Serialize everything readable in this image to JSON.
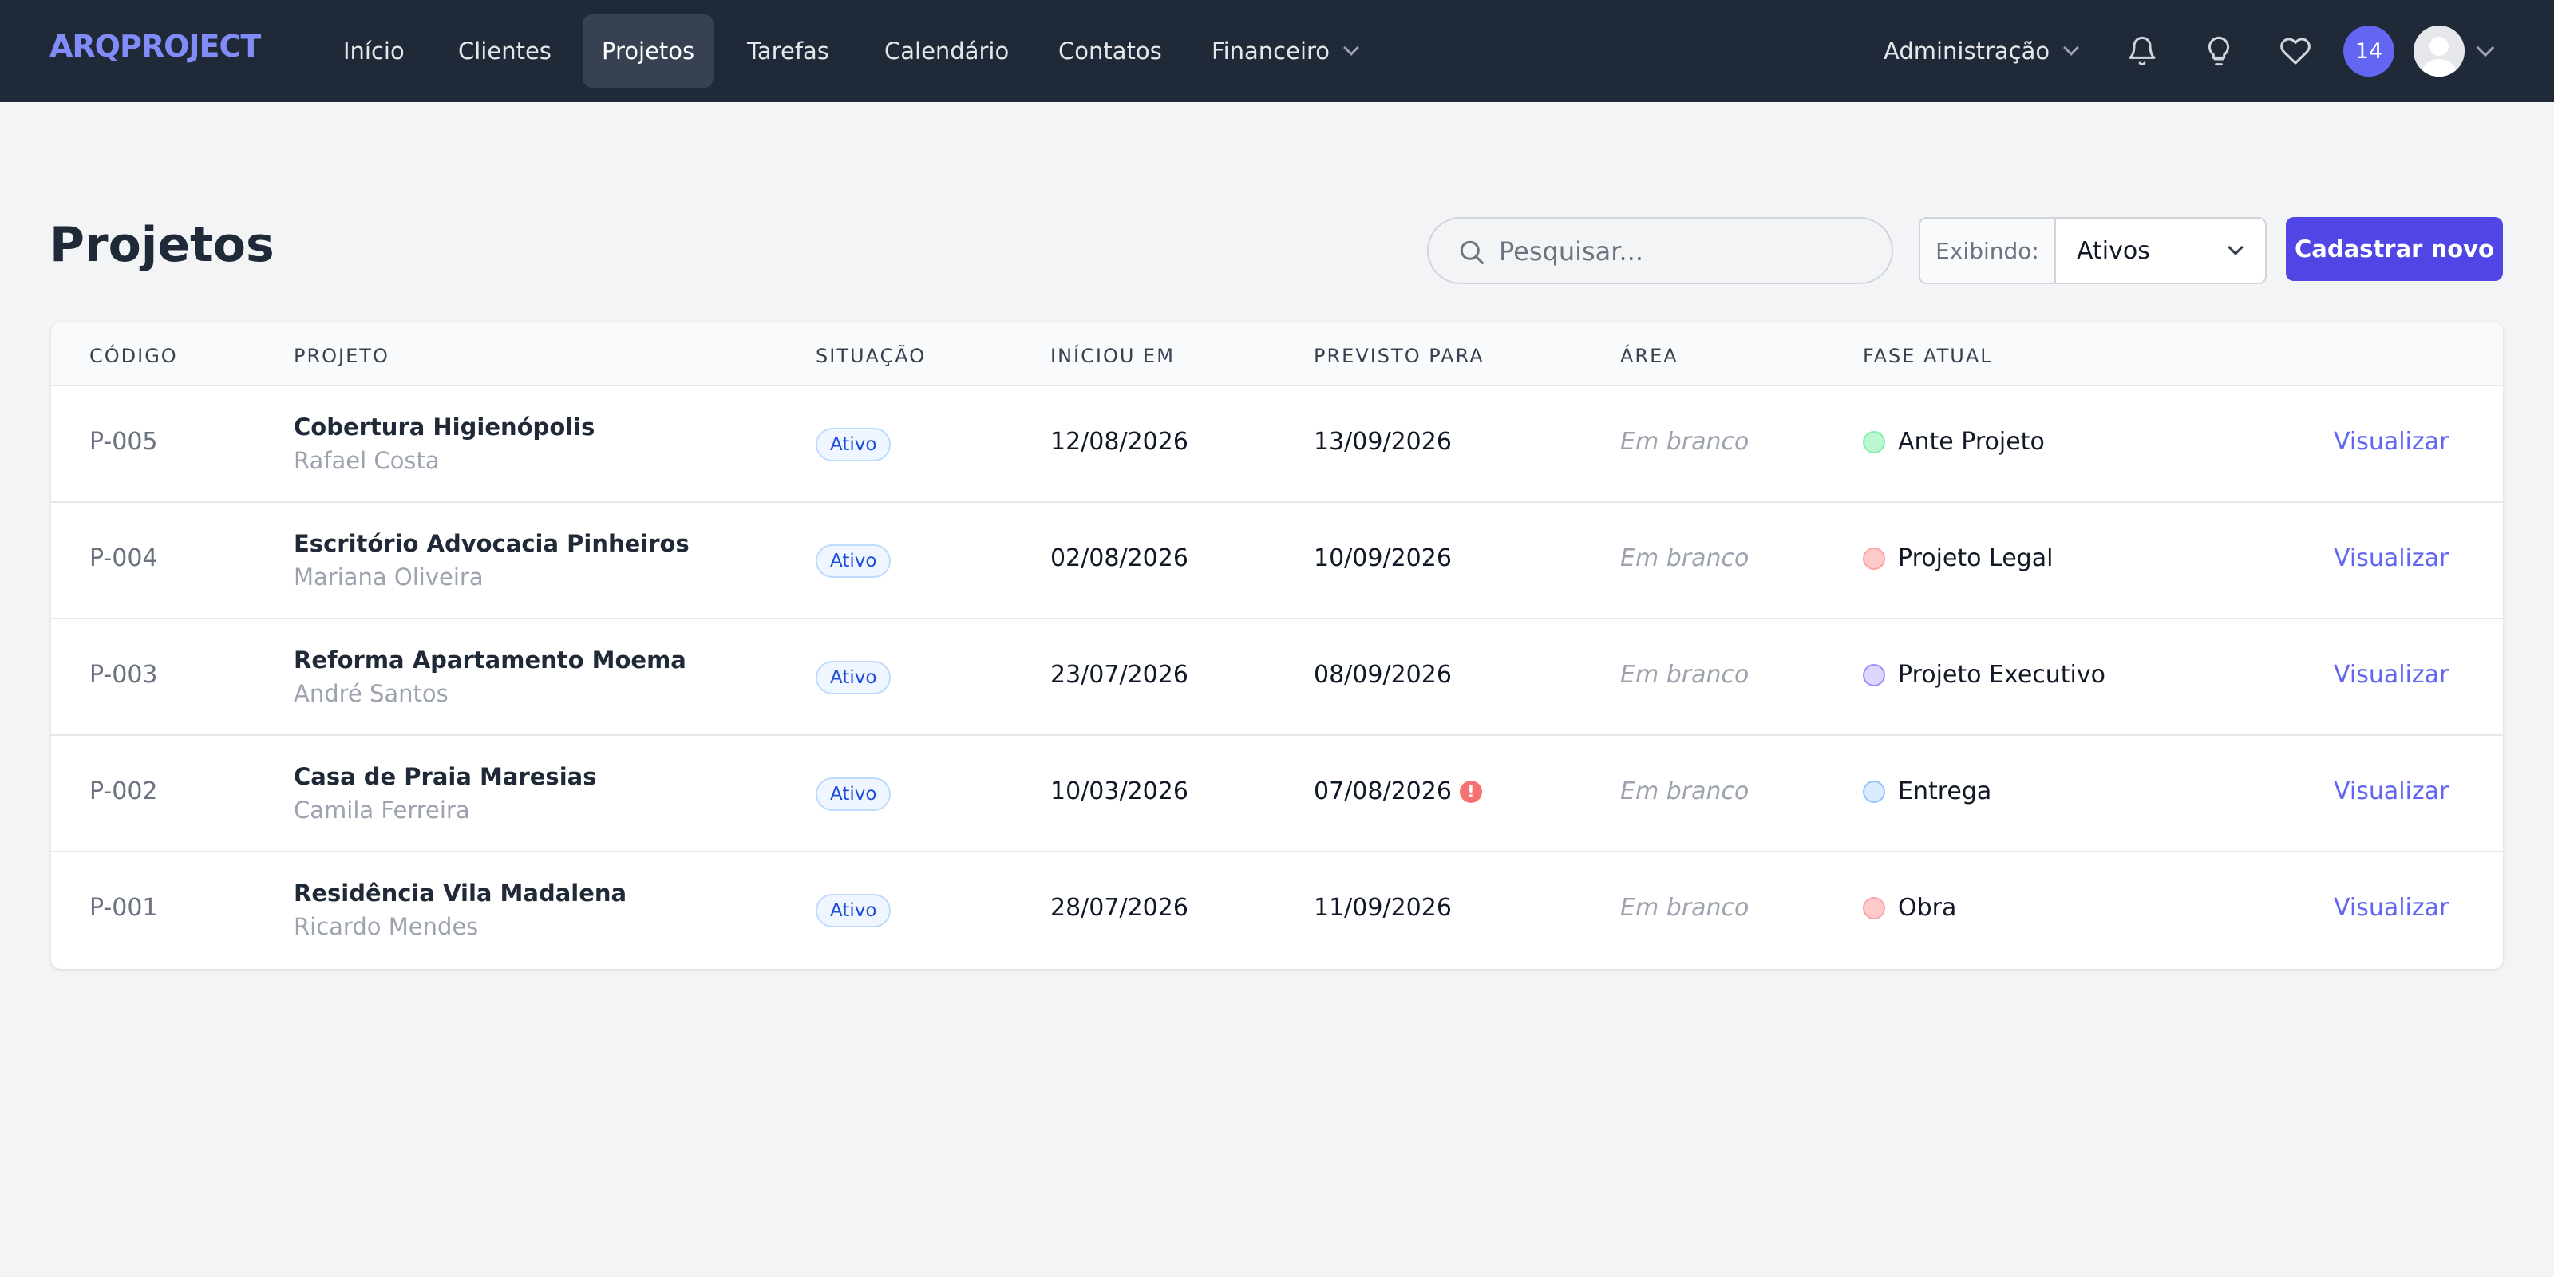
{
  "app": {
    "logo": "ARQPROJECT"
  },
  "nav": {
    "items": [
      {
        "label": "Início"
      },
      {
        "label": "Clientes"
      },
      {
        "label": "Projetos"
      },
      {
        "label": "Tarefas"
      },
      {
        "label": "Calendário"
      },
      {
        "label": "Contatos"
      },
      {
        "label": "Financeiro"
      }
    ],
    "admin_label": "Administração",
    "notification_count": "14"
  },
  "page": {
    "title": "Projetos",
    "search_placeholder": "Pesquisar...",
    "filter_label": "Exibindo:",
    "filter_value": "Ativos",
    "new_button": "Cadastrar novo"
  },
  "table": {
    "headers": {
      "code": "CÓDIGO",
      "project": "PROJETO",
      "status": "SITUAÇÃO",
      "start": "INÍCIOU EM",
      "due": "PREVISTO PARA",
      "area": "ÁREA",
      "phase": "FASE ATUAL"
    },
    "rows": [
      {
        "code": "P-005",
        "name": "Cobertura Higienópolis",
        "client": "Rafael Costa",
        "status": "Ativo",
        "start": "12/08/2026",
        "due": "13/09/2026",
        "area": "Em branco",
        "phase": "Ante Projeto",
        "action": "Visualizar"
      },
      {
        "code": "P-004",
        "name": "Escritório Advocacia Pinheiros",
        "client": "Mariana Oliveira",
        "status": "Ativo",
        "start": "02/08/2026",
        "due": "10/09/2026",
        "area": "Em branco",
        "phase": "Projeto Legal",
        "action": "Visualizar"
      },
      {
        "code": "P-003",
        "name": "Reforma Apartamento Moema",
        "client": "André Santos",
        "status": "Ativo",
        "start": "23/07/2026",
        "due": "08/09/2026",
        "area": "Em branco",
        "phase": "Projeto Executivo",
        "action": "Visualizar"
      },
      {
        "code": "P-002",
        "name": "Casa de Praia Maresias",
        "client": "Camila Ferreira",
        "status": "Ativo",
        "start": "10/03/2026",
        "due": "07/08/2026",
        "overdue_mark": "!",
        "area": "Em branco",
        "phase": "Entrega",
        "action": "Visualizar"
      },
      {
        "code": "P-001",
        "name": "Residência Vila Madalena",
        "client": "Ricardo Mendes",
        "status": "Ativo",
        "start": "28/07/2026",
        "due": "11/09/2026",
        "area": "Em branco",
        "phase": "Obra",
        "action": "Visualizar"
      }
    ]
  },
  "colors": {
    "navbar_bg": "#1f2937",
    "accent": "#4f46e5",
    "phase_ante_projeto": "#bbf7d0",
    "phase_projeto_legal": "#fecaca",
    "phase_projeto_executivo": "#ddd6fe",
    "phase_entrega": "#dbeafe",
    "phase_obra": "#fecaca",
    "overdue": "#f87171"
  }
}
